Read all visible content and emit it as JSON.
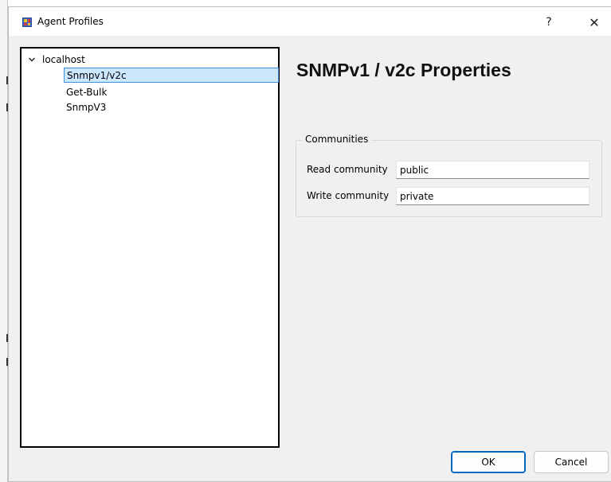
{
  "window": {
    "title": "Agent Profiles",
    "help_glyph": "?",
    "close_glyph": "✕",
    "app_icon": "agent-profiles-app-icon"
  },
  "tree": {
    "root": {
      "label": "localhost",
      "expanded": true,
      "toggle_icon": "chevron-down-icon"
    },
    "items": [
      {
        "label": "Snmpv1/v2c",
        "selected": true
      },
      {
        "label": "Get-Bulk",
        "selected": false
      },
      {
        "label": "SnmpV3",
        "selected": false
      }
    ]
  },
  "properties": {
    "title": "SNMPv1 / v2c Properties",
    "group_label": "Communities",
    "read_community": {
      "label": "Read community",
      "value": "public"
    },
    "write_community": {
      "label": "Write community",
      "value": "private"
    }
  },
  "buttons": {
    "ok_label": "OK",
    "cancel_label": "Cancel"
  },
  "colors": {
    "selection_bg": "#cce8ff",
    "selection_border": "#3c8fdd",
    "default_button_border": "#0067c0"
  }
}
